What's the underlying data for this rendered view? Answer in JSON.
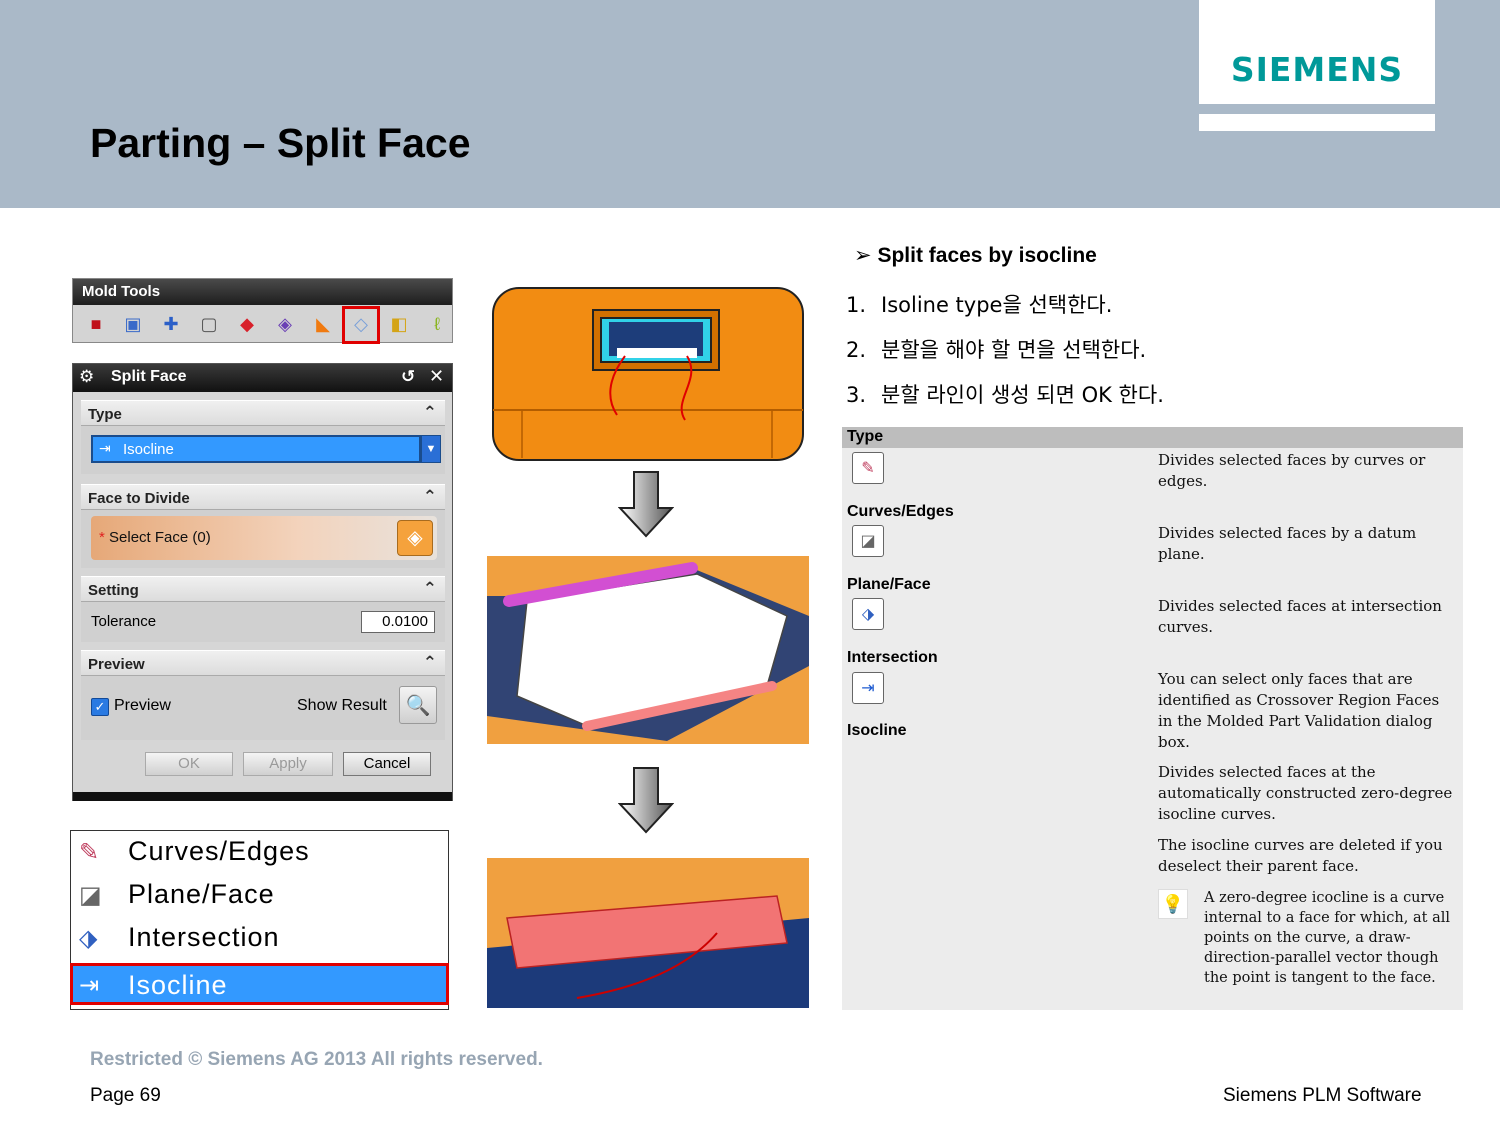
{
  "header": {
    "title": "Parting – Split Face",
    "logo": "SIEMENS",
    "bg_color": "#aab9c8",
    "logo_color": "#009999"
  },
  "toolbar": {
    "title": "Mold Tools",
    "icons": [
      "mold-cube-icon",
      "mold-box-icon",
      "axis-icon",
      "frame-icon",
      "red-solid-icon",
      "grid-icon",
      "wedge-icon",
      "split-face-icon",
      "layer-icon",
      "lasso-icon"
    ],
    "highlighted": "split-face-icon"
  },
  "dialog": {
    "title": "Split Face",
    "sections": {
      "type": {
        "label": "Type",
        "value": "Isocline"
      },
      "face": {
        "label": "Face to Divide",
        "select_label": "Select Face (0)",
        "required_mark": "*"
      },
      "setting": {
        "label": "Setting",
        "tolerance_label": "Tolerance",
        "tolerance_value": "0.0100"
      },
      "preview": {
        "label": "Preview",
        "checkbox_label": "Preview",
        "show_result": "Show Result",
        "checked": true
      }
    },
    "buttons": {
      "ok": "OK",
      "apply": "Apply",
      "cancel": "Cancel"
    }
  },
  "type_menu": {
    "items": [
      "Curves/Edges",
      "Plane/Face",
      "Intersection",
      "Isocline"
    ],
    "selected": "Isocline"
  },
  "instructions": {
    "bullet": "Split faces by isocline",
    "steps": [
      "Isoline type을 선택한다.",
      "분할을 해야 할 면을 선택한다.",
      "분할 라인이 생성 되면 OK 한다."
    ],
    "step_numbers": [
      "1.",
      "2.",
      "3."
    ]
  },
  "reference": {
    "header": "Type",
    "labels": [
      "Curves/Edges",
      "Plane/Face",
      "Intersection",
      "Isocline"
    ],
    "descriptions": [
      "Divides selected faces by curves or edges.",
      "Divides selected faces by a datum plane.",
      "Divides selected faces at intersection curves.",
      "You can select only faces that are identified as Crossover Region Faces in the Molded Part Validation dialog box.",
      "Divides selected faces at the automatically constructed zero-degree isocline curves.",
      "The isocline curves are deleted if you deselect their parent face.",
      "A zero-degree icocline is a curve internal to a face for which, at all points on the curve, a draw-direction-parallel vector though the point is tangent to the face."
    ]
  },
  "footer": {
    "restricted": "Restricted © Siemens AG 2013 All rights reserved.",
    "page": "Page 69",
    "company": "Siemens PLM Software"
  }
}
